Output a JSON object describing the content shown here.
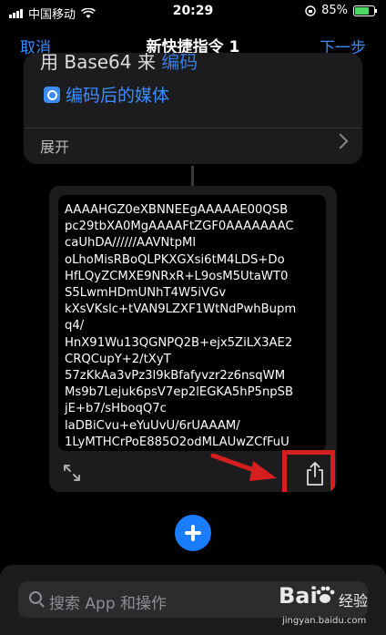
{
  "status_bar": {
    "carrier": "中国移动",
    "time": "20:29",
    "battery_percent": "85%",
    "battery_level": 0.85
  },
  "nav": {
    "cancel": "取消",
    "title": "新快捷指令 1",
    "next": "下一步"
  },
  "action_card": {
    "clipped_text_black": "用 Base64 来",
    "clipped_text_blue": "编码",
    "media_variable": "编码后的媒体",
    "expand_label": "展开"
  },
  "result_card": {
    "code_lines": [
      "AAAAHGZ0eXBNNEEgAAAAAE00QSB",
      "pc29tbXA0MgAAAAFtZGF0AAAAAAAC",
      "caUhDA//////AAVNtpMl",
      "oLhoMisRBoQLPKXGXsi6tM4LDS+Do",
      "HfLQyZCMXE9NRxR+L9osM5UtaWT0",
      "S5LwmHDmUNhT4W5iVGv",
      "kXsVKslc+tVAN9LZXF1WtNdPwhBupm",
      "q4/",
      "HnX91Wu13QGNPQ2B+ejx5ZiLX3AE2",
      "CRQCupY+2/tXyT",
      "57zKkAa3vPz3l9kBfafyvzr2z6nsqWM",
      "Ms9b7Lejuk6psV7ep2lEGKA5hP5npSB",
      "jE+b7/sHboqQ7c",
      "laDBiCvu+eYuUvU/6rUAAAM/",
      "1LyMTHCrPoE885O2odMLAUwZCfFuU"
    ]
  },
  "bottom_sheet": {
    "search_placeholder": "搜索 App 和操作"
  },
  "watermark": {
    "logo_text": "Bai",
    "brand_text": "经验",
    "url": "jingyan.baidu.com"
  },
  "colors": {
    "accent": "#3b8cff",
    "highlight": "#d51f1f",
    "add_button": "#1a7cff"
  }
}
